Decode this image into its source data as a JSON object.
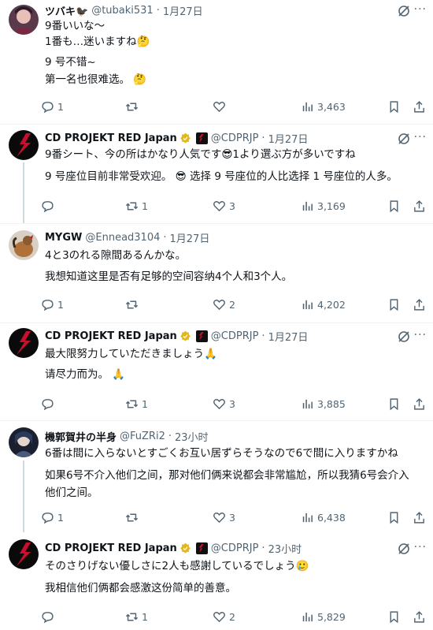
{
  "colors": {
    "text": "#0f1419",
    "secondary": "#536471",
    "border": "#eff3f4",
    "verified": "#e2b719",
    "brand_red": "#c8102e"
  },
  "tweets": [
    {
      "name": "ツバキ🐦‍⬛",
      "handle": "@tubaki531",
      "time": "1月27日",
      "text_lines": [
        "9番いいな〜",
        "1番も…迷いますね🤔"
      ],
      "translation_lines": [
        "9 号不错~",
        "第一名也很难选。 🤔"
      ],
      "reply_count": "1",
      "retweet_count": "",
      "like_count": "",
      "view_count": "3,463"
    },
    {
      "name": "CD PROJEKT RED Japan",
      "handle": "@CDPRJP",
      "time": "1月27日",
      "text_lines": [
        "9番シート、今の所はかなり人気です😎1より選ぶ方が多いですね"
      ],
      "translation_lines": [
        "9 号座位目前非常受欢迎。 😎  选择 9 号座位的人比选择 1 号座位的人多。"
      ],
      "reply_count": "",
      "retweet_count": "1",
      "like_count": "3",
      "view_count": "3,169"
    },
    {
      "name": "MYGW",
      "handle": "@Ennead3104",
      "time": "1月27日",
      "text_lines": [
        "4と3のれる隙間あるんかな。"
      ],
      "translation_lines": [
        "我想知道这里是否有足够的空间容纳4个人和3个人。"
      ],
      "reply_count": "1",
      "retweet_count": "",
      "like_count": "2",
      "view_count": "4,202"
    },
    {
      "name": "CD PROJEKT RED Japan",
      "handle": "@CDPRJP",
      "time": "1月27日",
      "text_lines": [
        "最大限努力していただきましょう🙏"
      ],
      "translation_lines": [
        "请尽力而为。 🙏"
      ],
      "reply_count": "",
      "retweet_count": "1",
      "like_count": "3",
      "view_count": "3,885"
    },
    {
      "name": "機郭賀井の半身",
      "handle": "@FuZRi2",
      "time": "23小时",
      "text_lines": [
        "6番は間に入らないとすごくお互い居ずらそうなので6で間に入りますかね"
      ],
      "translation_lines": [
        "如果6号不介入他们之间，那对他们俩来说都会非常尴尬，所以我猜6号会介入",
        "他们之间。"
      ],
      "reply_count": "1",
      "retweet_count": "",
      "like_count": "3",
      "view_count": "6,438"
    },
    {
      "name": "CD PROJEKT RED Japan",
      "handle": "@CDPRJP",
      "time": "23小时",
      "text_lines": [
        "そのさりげない優しさに2人も感謝しているでしょう🥲"
      ],
      "translation_lines": [
        "我相信他们俩都会感激这份简单的善意。"
      ],
      "reply_count": "",
      "retweet_count": "1",
      "like_count": "2",
      "view_count": "5,829"
    }
  ]
}
